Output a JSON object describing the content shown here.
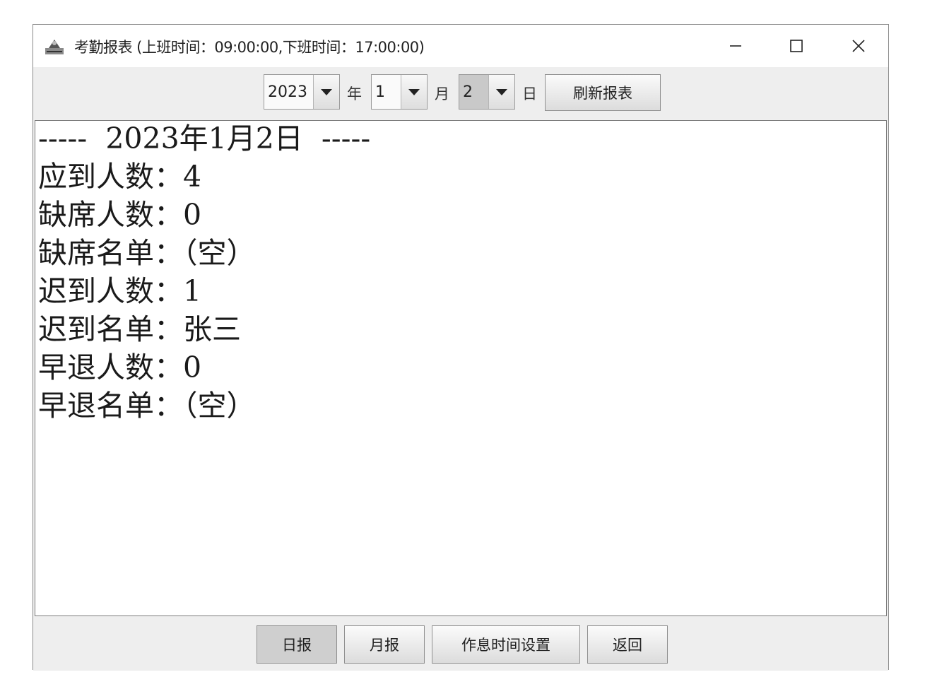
{
  "window": {
    "title": "考勤报表 (上班时间：09:00:00,下班时间：17:00:00)",
    "controls": {
      "minimize": "minimize-icon",
      "maximize": "maximize-icon",
      "close": "close-icon"
    }
  },
  "toolbar": {
    "year_value": "2023",
    "year_unit": "年",
    "month_value": "1",
    "month_unit": "月",
    "day_value": "2",
    "day_unit": "日",
    "refresh_label": "刷新报表"
  },
  "report": {
    "header": "-----  2023年1月2日  -----",
    "lines": [
      "应到人数：4",
      "缺席人数：0",
      "缺席名单：（空）",
      "迟到人数：1",
      "迟到名单：张三",
      "早退人数：0",
      "早退名单：（空）"
    ]
  },
  "bottom": {
    "daily_label": "日报",
    "monthly_label": "月报",
    "schedule_label": "作息时间设置",
    "back_label": "返回"
  },
  "colors": {
    "window_bg": "#eeeeee",
    "report_bg": "#ffffff",
    "pressed_button": "#cfcfcf"
  }
}
